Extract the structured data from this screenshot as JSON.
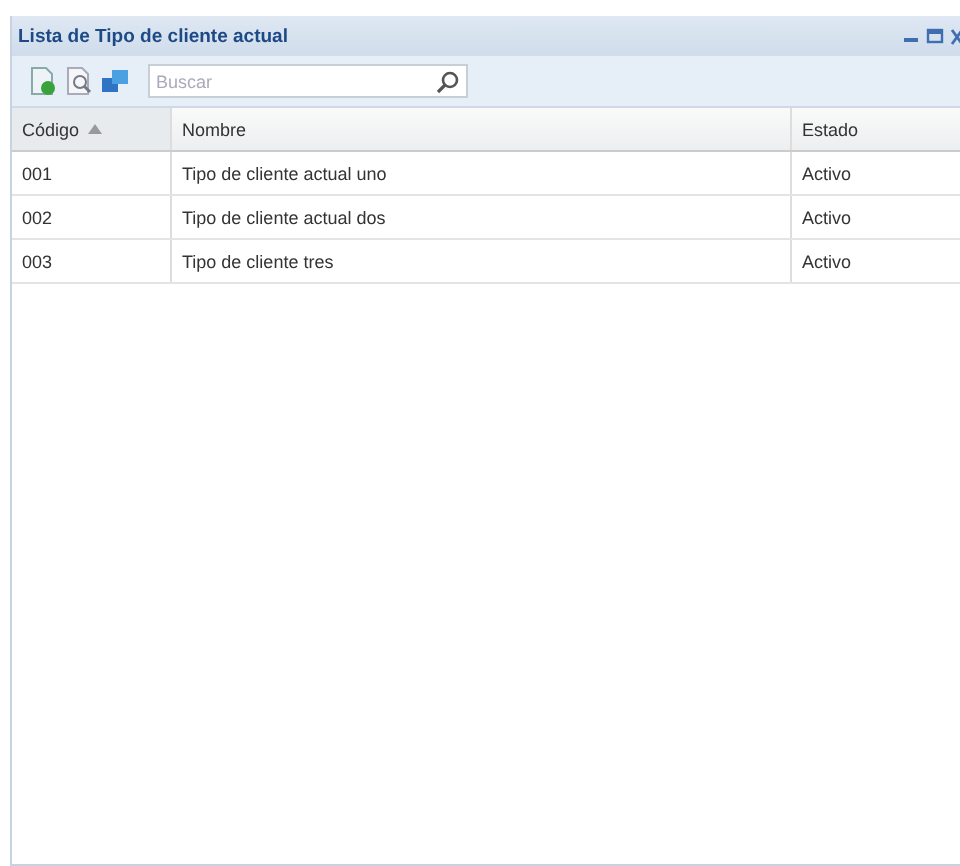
{
  "window": {
    "title": "Lista de Tipo de cliente actual"
  },
  "search": {
    "placeholder": "Buscar"
  },
  "table": {
    "columns": [
      {
        "label": "Código",
        "sorted": true
      },
      {
        "label": "Nombre",
        "sorted": false
      },
      {
        "label": "Estado",
        "sorted": false
      }
    ],
    "rows": [
      {
        "cells": [
          "001",
          "Tipo de cliente actual uno",
          "Activo"
        ]
      },
      {
        "cells": [
          "002",
          "Tipo de cliente actual dos",
          "Activo"
        ]
      },
      {
        "cells": [
          "003",
          "Tipo de cliente tres",
          "Activo"
        ]
      }
    ]
  }
}
